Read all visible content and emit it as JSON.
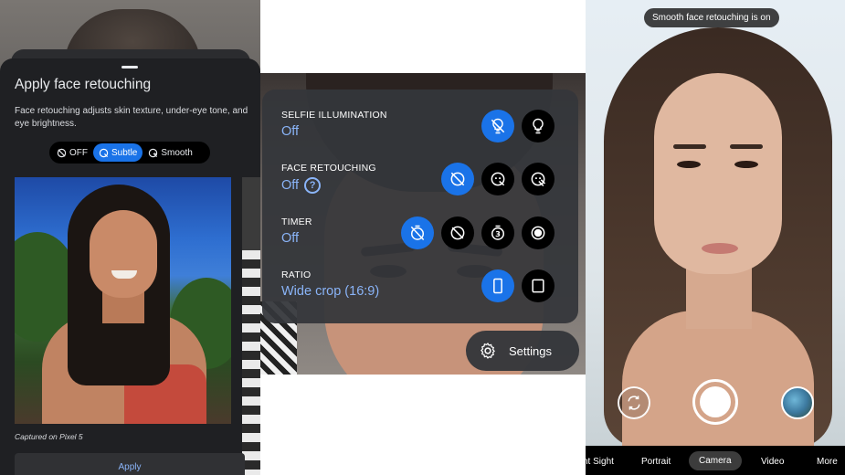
{
  "retouch_sheet": {
    "title": "Apply face retouching",
    "description": "Face retouching adjusts skin texture, under-eye tone, and eye brightness.",
    "options": [
      {
        "label": "OFF",
        "icon": "face-off-icon",
        "selected": false
      },
      {
        "label": "Subtle",
        "icon": "face-subtle-icon",
        "selected": true
      },
      {
        "label": "Smooth",
        "icon": "face-smooth-icon",
        "selected": false
      }
    ],
    "caption": "Captured on Pixel 5",
    "apply_label": "Apply"
  },
  "quick_settings": {
    "rows": [
      {
        "label": "SELFIE ILLUMINATION",
        "value": "Off",
        "options": [
          "illumination-off-icon",
          "bulb-icon"
        ],
        "selected_index": 0
      },
      {
        "label": "FACE RETOUCHING",
        "value": "Off",
        "help_icon": "help-icon",
        "options": [
          "face-off-icon",
          "face-subtle-icon",
          "face-smooth-icon"
        ],
        "selected_index": 0
      },
      {
        "label": "TIMER",
        "value": "Off",
        "options": [
          "timer-off-icon",
          "timer-off-alt-icon",
          "timer-3s-icon",
          "timer-10s-icon"
        ],
        "selected_index": 0
      },
      {
        "label": "RATIO",
        "value": "Wide crop (16:9)",
        "options": [
          "ratio-16-9-icon",
          "ratio-4-3-icon"
        ],
        "selected_index": 0
      }
    ],
    "settings_label": "Settings",
    "timer_3s_glyph": "3"
  },
  "camera": {
    "toast": "Smooth face retouching is on",
    "modes": [
      "nt Sight",
      "Portrait",
      "Camera",
      "Video",
      "More"
    ],
    "selected_mode": "Camera"
  },
  "colors": {
    "accent": "#1a73e8",
    "accent_text": "#8ab4f8",
    "sheet_bg": "#1f2023",
    "menu_bg": "#34363a"
  }
}
